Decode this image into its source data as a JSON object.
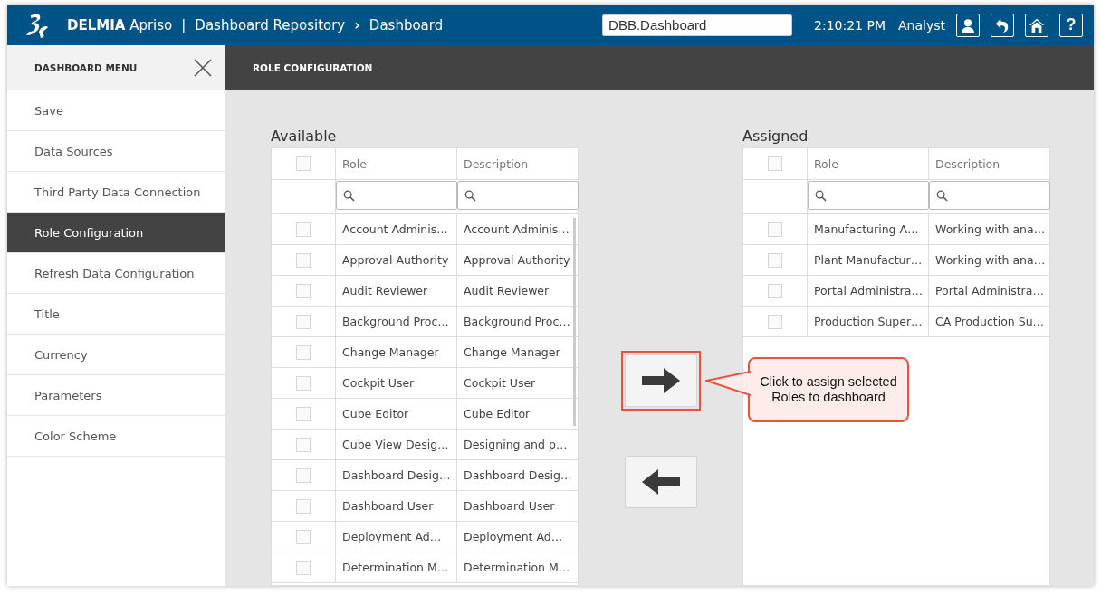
{
  "header": {
    "brand_bold": "DELMIA",
    "brand_light": "Apriso",
    "separator": "|",
    "breadcrumb": [
      {
        "label": "Dashboard Repository"
      },
      {
        "label": "Dashboard"
      }
    ],
    "breadcrumb_separator": "›",
    "search_value": "DBB.Dashboard",
    "time": "2:10:21 PM",
    "user": "Analyst",
    "help_label": "?"
  },
  "sidebar": {
    "title": "DASHBOARD MENU",
    "items": [
      {
        "label": "Save",
        "selected": false
      },
      {
        "label": "Data Sources",
        "selected": false
      },
      {
        "label": "Third Party Data Connection",
        "selected": false
      },
      {
        "label": "Role Configuration",
        "selected": true
      },
      {
        "label": "Refresh Data Configuration",
        "selected": false
      },
      {
        "label": "Title",
        "selected": false
      },
      {
        "label": "Currency",
        "selected": false
      },
      {
        "label": "Parameters",
        "selected": false
      },
      {
        "label": "Color Scheme",
        "selected": false
      }
    ]
  },
  "page_title": "ROLE CONFIGURATION",
  "panels": [
    {
      "title": "Available",
      "select_all_checked": false,
      "columns": [
        "Role",
        "Description"
      ],
      "scrollbar": true,
      "rows": [
        {
          "role": "Account Adminis…",
          "description": "Account Adminis…",
          "checked": false
        },
        {
          "role": "Approval Authority",
          "description": "Approval Authority",
          "checked": false
        },
        {
          "role": "Audit Reviewer",
          "description": "Audit Reviewer",
          "checked": false
        },
        {
          "role": "Background Proc…",
          "description": "Background Proc…",
          "checked": false
        },
        {
          "role": "Change Manager",
          "description": "Change Manager",
          "checked": false
        },
        {
          "role": "Cockpit User",
          "description": "Cockpit User",
          "checked": false
        },
        {
          "role": "Cube Editor",
          "description": "Cube Editor",
          "checked": false
        },
        {
          "role": "Cube View Desig…",
          "description": "Designing and p…",
          "checked": false
        },
        {
          "role": "Dashboard Desig…",
          "description": "Dashboard Desig…",
          "checked": false
        },
        {
          "role": "Dashboard User",
          "description": "Dashboard User",
          "checked": false
        },
        {
          "role": "Deployment Ad…",
          "description": "Deployment Ad…",
          "checked": false
        },
        {
          "role": "Determination M…",
          "description": "Determination M…",
          "checked": false
        }
      ]
    },
    {
      "title": "Assigned",
      "select_all_checked": false,
      "columns": [
        "Role",
        "Description"
      ],
      "scrollbar": false,
      "rows": [
        {
          "role": "Manufacturing A…",
          "description": "Working with ana…",
          "checked": false
        },
        {
          "role": "Plant Manufactur…",
          "description": "Working with ana…",
          "checked": false
        },
        {
          "role": "Portal Administra…",
          "description": "Portal Administra…",
          "checked": false
        },
        {
          "role": "Production Super…",
          "description": "CA Production Su…",
          "checked": false
        }
      ]
    }
  ],
  "transfer_buttons": [
    {
      "kind": "assign",
      "highlighted": true
    },
    {
      "kind": "unassign",
      "highlighted": false
    }
  ],
  "callout": {
    "text": "Click to assign selected Roles to dashboard"
  }
}
